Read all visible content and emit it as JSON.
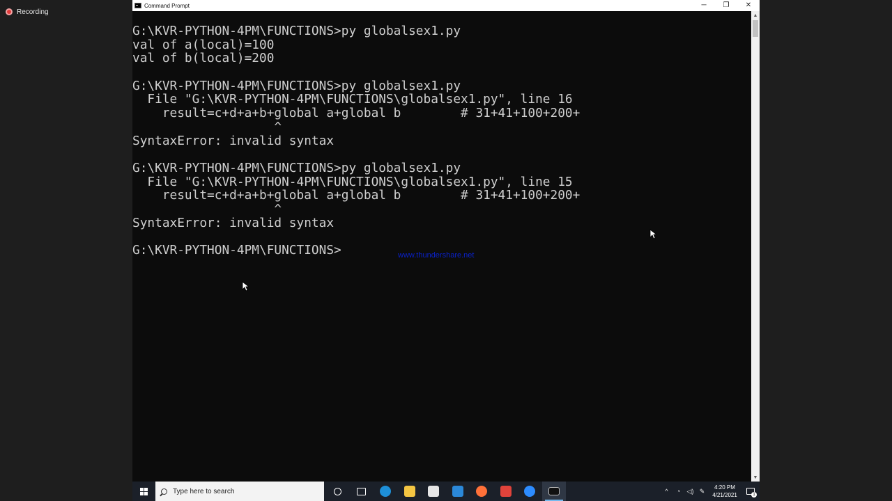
{
  "recording": {
    "label": "Recording"
  },
  "window": {
    "title": "Command Prompt",
    "controls": {
      "minimize": "─",
      "restore": "❐",
      "close": "✕"
    }
  },
  "console": {
    "lines": [
      "G:\\KVR-PYTHON-4PM\\FUNCTIONS>py globalsex1.py",
      "val of a(local)=100",
      "val of b(local)=200",
      "",
      "G:\\KVR-PYTHON-4PM\\FUNCTIONS>py globalsex1.py",
      "  File \"G:\\KVR-PYTHON-4PM\\FUNCTIONS\\globalsex1.py\", line 16",
      "    result=c+d+a+b+global a+global b        # 31+41+100+200+",
      "                   ^",
      "SyntaxError: invalid syntax",
      "",
      "G:\\KVR-PYTHON-4PM\\FUNCTIONS>py globalsex1.py",
      "  File \"G:\\KVR-PYTHON-4PM\\FUNCTIONS\\globalsex1.py\", line 15",
      "    result=c+d+a+b+global a+global b        # 31+41+100+200+",
      "                   ^",
      "SyntaxError: invalid syntax",
      "",
      "G:\\KVR-PYTHON-4PM\\FUNCTIONS>"
    ]
  },
  "watermark": {
    "text": "www.thundershare.net"
  },
  "taskbar": {
    "search_placeholder": "Type here to search",
    "apps": [
      {
        "name": "cortana-icon",
        "color": "#ffffff"
      },
      {
        "name": "task-view-icon",
        "color": "#ffffff"
      },
      {
        "name": "edge-icon",
        "color": "#1e8fd8"
      },
      {
        "name": "file-explorer-icon",
        "color": "#f4c542"
      },
      {
        "name": "store-icon",
        "color": "#e6e6e6"
      },
      {
        "name": "mail-icon",
        "color": "#2b88d8"
      },
      {
        "name": "firefox-icon",
        "color": "#ff7139"
      },
      {
        "name": "app-red-icon",
        "color": "#e0433b"
      },
      {
        "name": "zoom-icon",
        "color": "#2d8cff"
      },
      {
        "name": "command-prompt-icon",
        "color": "#cccccc"
      }
    ],
    "clock": {
      "time": "4:20 PM",
      "date": "4/21/2021"
    },
    "notification_count": "1"
  }
}
